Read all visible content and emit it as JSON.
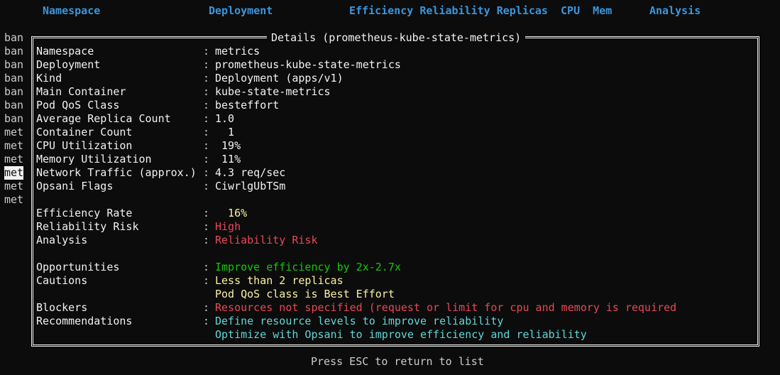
{
  "header": {
    "namespace": "Namespace",
    "deployment": "Deployment",
    "metrics": "Efficiency Reliability Replicas  CPU  Mem",
    "analysis": "Analysis"
  },
  "background_list": [
    "ban",
    "ban",
    "ban",
    "ban",
    "ban",
    "ban",
    "ban",
    "met",
    "met",
    "met",
    "met",
    "met",
    "met"
  ],
  "selected_index": 10,
  "details": {
    "title": "Details (prometheus-kube-state-metrics)",
    "separator": ":",
    "rows": [
      {
        "label": "Namespace",
        "value": "metrics",
        "color": "white"
      },
      {
        "label": "Deployment",
        "value": "prometheus-kube-state-metrics",
        "color": "white"
      },
      {
        "label": "Kind",
        "value": "Deployment (apps/v1)",
        "color": "white"
      },
      {
        "label": "Main Container",
        "value": "kube-state-metrics",
        "color": "white"
      },
      {
        "label": "Pod QoS Class",
        "value": "besteffort",
        "color": "white"
      },
      {
        "label": "Average Replica Count",
        "value": "1.0",
        "color": "white"
      },
      {
        "label": "Container Count",
        "value": "  1",
        "color": "white"
      },
      {
        "label": "CPU Utilization",
        "value": " 19%",
        "color": "white"
      },
      {
        "label": "Memory Utilization",
        "value": " 11%",
        "color": "white"
      },
      {
        "label": "Network Traffic (approx.)",
        "value": "4.3 req/sec",
        "color": "white"
      },
      {
        "label": "Opsani Flags",
        "value": "CiwrlgUbTSm",
        "color": "white"
      },
      {
        "label": "Efficiency Rate",
        "value": "  16%",
        "color": "yellow"
      },
      {
        "label": "Reliability Risk",
        "value": "High",
        "color": "red"
      },
      {
        "label": "Analysis",
        "value": "Reliability Risk",
        "color": "red"
      },
      {
        "label": "Opportunities",
        "value": "Improve efficiency by 2x-2.7x",
        "color": "green"
      },
      {
        "label": "Cautions",
        "value": "Less than 2 replicas",
        "color": "yellow"
      },
      {
        "label": "",
        "value": "Pod QoS class is Best Effort",
        "color": "yellow"
      },
      {
        "label": "Blockers",
        "value": "Resources not specified (request or limit for cpu and memory is required",
        "color": "red"
      },
      {
        "label": "Recommendations",
        "value": "Define resource levels to improve reliability",
        "color": "cyan"
      },
      {
        "label": "",
        "value": "Optimize with Opsani to improve efficiency and reliability",
        "color": "cyan"
      }
    ]
  },
  "footer": "Press ESC to return to list"
}
